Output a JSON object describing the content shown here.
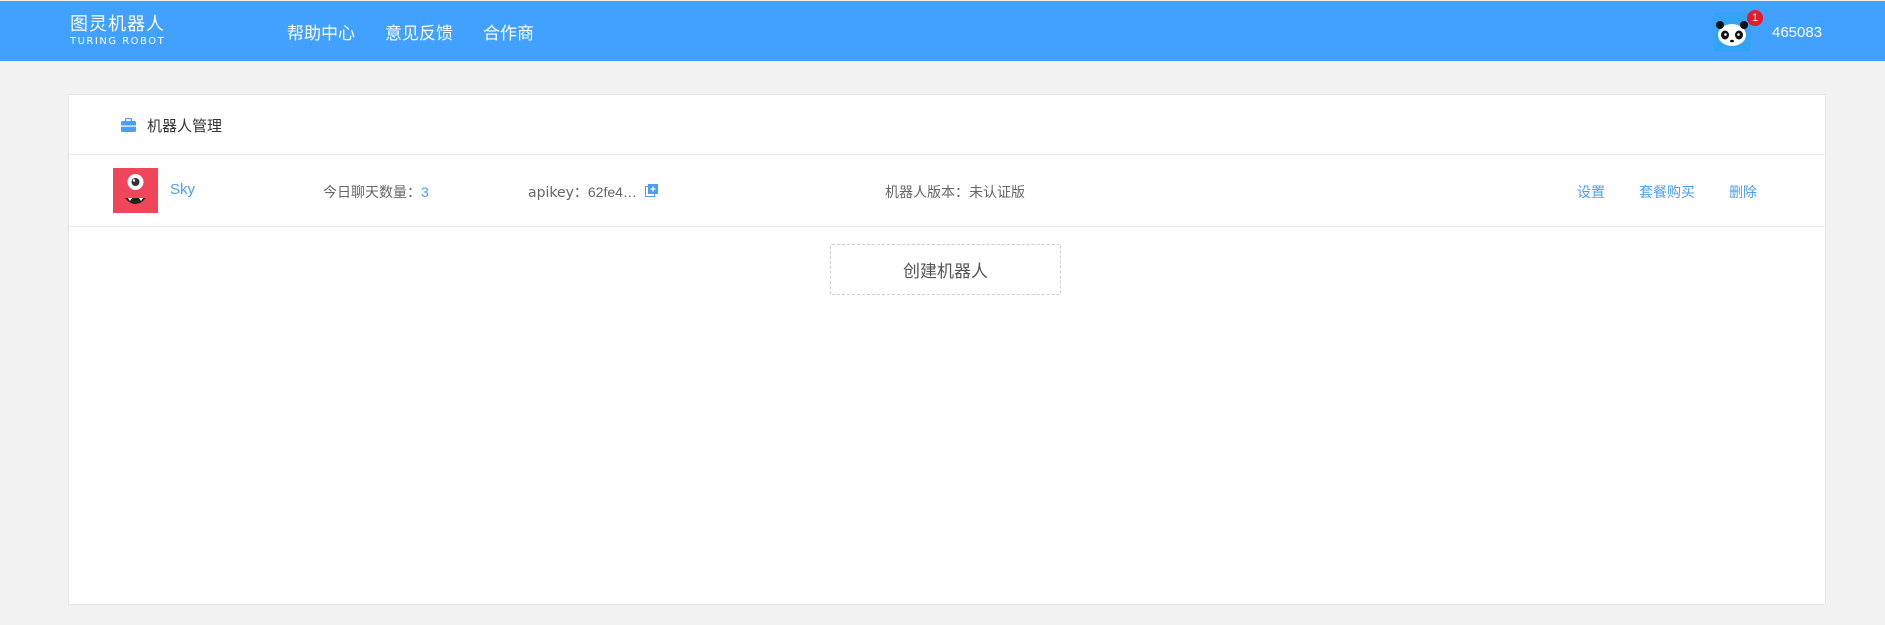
{
  "header": {
    "logo_cn": "图灵机器人",
    "logo_en": "TURING ROBOT",
    "nav": [
      {
        "label": "帮助中心"
      },
      {
        "label": "意见反馈"
      },
      {
        "label": "合作商"
      }
    ],
    "notification_count": "1",
    "username": "465083",
    "avatar_icon": "panda-avatar-icon",
    "accent_color": "#42a0ff"
  },
  "panel": {
    "title": "机器人管理",
    "title_icon": "toolbox-icon"
  },
  "robots": [
    {
      "name": "Sky",
      "avatar_icon": "red-monster-avatar-icon",
      "chat_count_label": "今日聊天数量：",
      "chat_count": "3",
      "apikey_label": "apikey：",
      "apikey_value": "62fe4…",
      "version_label": "机器人版本：",
      "version_value": "未认证版",
      "actions": {
        "settings": "设置",
        "purchase": "套餐购买",
        "delete": "删除"
      }
    }
  ],
  "create_button": "创建机器人",
  "link_color": "#4a9ff5"
}
